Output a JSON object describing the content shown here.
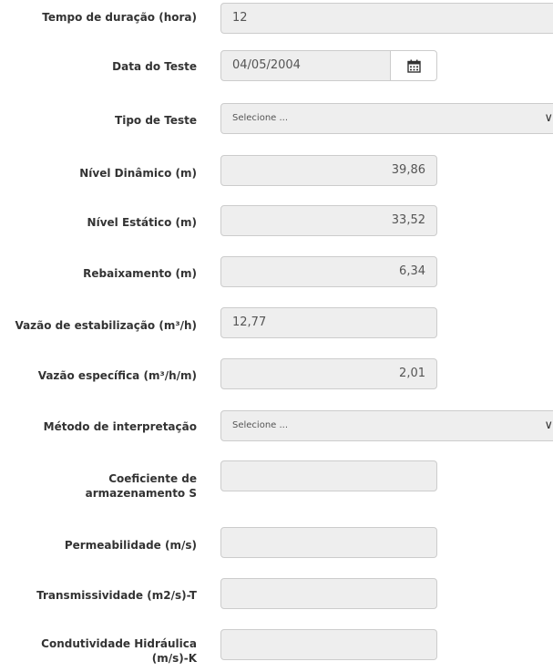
{
  "form": {
    "duracao": {
      "label": "Tempo de duração (hora)",
      "value": "12"
    },
    "data_teste": {
      "label": "Data do Teste",
      "value": "04/05/2004"
    },
    "tipo_teste": {
      "label": "Tipo de Teste",
      "value": "Selecione ..."
    },
    "nivel_dinamico": {
      "label": "Nível Dinâmico (m)",
      "value": "39,86"
    },
    "nivel_estatico": {
      "label": "Nível Estático (m)",
      "value": "33,52"
    },
    "rebaixamento": {
      "label": "Rebaixamento (m)",
      "value": "6,34"
    },
    "vazao_estabilizacao": {
      "label": "Vazão de estabilização (m³/h)",
      "value": "12,77"
    },
    "vazao_especifica": {
      "label": "Vazão específica (m³/h/m)",
      "value": "2,01"
    },
    "metodo": {
      "label": "Método de interpretação",
      "value": "Selecione ..."
    },
    "coef_armazenamento": {
      "label": "Coeficiente de armazenamento S",
      "value": ""
    },
    "permeabilidade": {
      "label": "Permeabilidade (m/s)",
      "value": ""
    },
    "transmissividade": {
      "label": "Transmissividade (m2/s)-T",
      "value": ""
    },
    "condutividade": {
      "label": "Condutividade Hidráulica (m/s)-K",
      "value": ""
    }
  },
  "icons": {
    "calendar": "calendar-icon",
    "caret": "chevron-down-icon"
  }
}
